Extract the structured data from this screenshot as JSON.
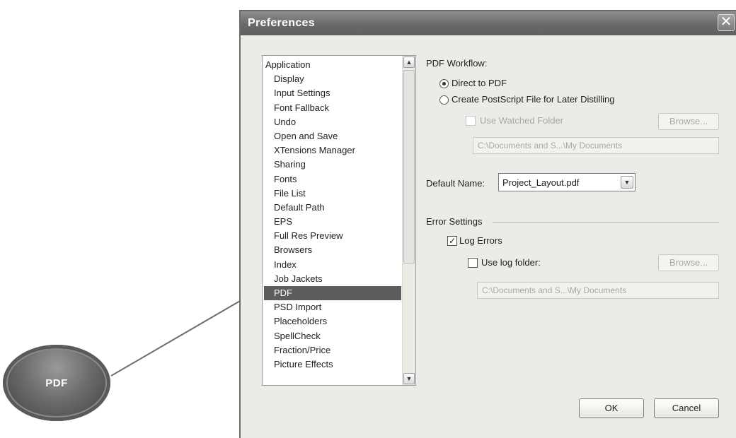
{
  "callout": {
    "label": "PDF"
  },
  "dialog": {
    "title": "Preferences",
    "close_glyph": "✕",
    "list": {
      "items": [
        {
          "label": "Application",
          "child": false,
          "selected": false
        },
        {
          "label": "Display",
          "child": true,
          "selected": false
        },
        {
          "label": "Input Settings",
          "child": true,
          "selected": false
        },
        {
          "label": "Font Fallback",
          "child": true,
          "selected": false
        },
        {
          "label": "Undo",
          "child": true,
          "selected": false
        },
        {
          "label": "Open and Save",
          "child": true,
          "selected": false
        },
        {
          "label": "XTensions Manager",
          "child": true,
          "selected": false
        },
        {
          "label": "Sharing",
          "child": true,
          "selected": false
        },
        {
          "label": "Fonts",
          "child": true,
          "selected": false
        },
        {
          "label": "File List",
          "child": true,
          "selected": false
        },
        {
          "label": "Default Path",
          "child": true,
          "selected": false
        },
        {
          "label": "EPS",
          "child": true,
          "selected": false
        },
        {
          "label": "Full Res Preview",
          "child": true,
          "selected": false
        },
        {
          "label": "Browsers",
          "child": true,
          "selected": false
        },
        {
          "label": "Index",
          "child": true,
          "selected": false
        },
        {
          "label": "Job Jackets",
          "child": true,
          "selected": false
        },
        {
          "label": "PDF",
          "child": true,
          "selected": true
        },
        {
          "label": "PSD Import",
          "child": true,
          "selected": false
        },
        {
          "label": "Placeholders",
          "child": true,
          "selected": false
        },
        {
          "label": "SpellCheck",
          "child": true,
          "selected": false
        },
        {
          "label": "Fraction/Price",
          "child": true,
          "selected": false
        },
        {
          "label": "Picture Effects",
          "child": true,
          "selected": false
        }
      ],
      "scroll_up_glyph": "▲",
      "scroll_down_glyph": "▼"
    },
    "pdf_workflow": {
      "label": "PDF Workflow:",
      "direct_label": "Direct to PDF",
      "postscript_label": "Create PostScript File for Later Distilling",
      "watched_folder_label": "Use Watched Folder",
      "browse_label": "Browse...",
      "watched_path": "C:\\Documents and S...\\My Documents"
    },
    "default_name": {
      "label": "Default Name:",
      "value": "Project_Layout.pdf",
      "dropdown_glyph": "▼"
    },
    "error_settings": {
      "label": "Error Settings",
      "log_errors_label": "Log Errors",
      "log_errors_check": "✓",
      "use_log_folder_label": "Use log folder:",
      "browse_label": "Browse...",
      "log_path": "C:\\Documents and S...\\My Documents"
    },
    "ok_label": "OK",
    "cancel_label": "Cancel"
  },
  "colors": {
    "titlebar": "#6a6a6a",
    "selection": "#5c5c5c",
    "dialog_bg": "#ecebe6",
    "callout": "#5a5a5a"
  }
}
